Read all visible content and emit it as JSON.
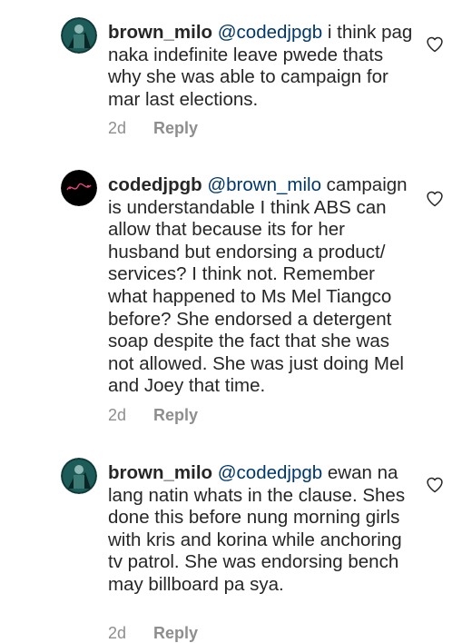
{
  "comments": [
    {
      "username": "brown_milo",
      "mention": "@codedjpgb",
      "text": " i think pag naka indefinite leave pwede thats why she was able to campaign for mar last elections.",
      "time": "2d",
      "reply_label": "Reply",
      "avatar_icon": "profile-photo-dark-teal"
    },
    {
      "username": "codedjpgb",
      "mention": "@brown_milo",
      "text": " campaign is understandable I think ABS can allow that because its for her husband but endorsing a product/ services? I think not. Remember what happened to Ms Mel Tiangco before? She endorsed a detergent soap despite the fact that she was not allowed. She was just doing Mel and Joey that time.",
      "time": "2d",
      "reply_label": "Reply",
      "avatar_icon": "profile-logo-black"
    },
    {
      "username": "brown_milo",
      "mention": "@codedjpgb",
      "text": " ewan na lang natin whats in the clause. Shes done this before nung morning girls with kris and korina while anchoring tv patrol. She was endorsing bench may billboard pa sya.",
      "time": "2d",
      "reply_label": "Reply",
      "avatar_icon": "profile-photo-dark-teal"
    }
  ],
  "colors": {
    "text": "#262626",
    "mention": "#00376b",
    "meta": "#8e8e8e"
  }
}
